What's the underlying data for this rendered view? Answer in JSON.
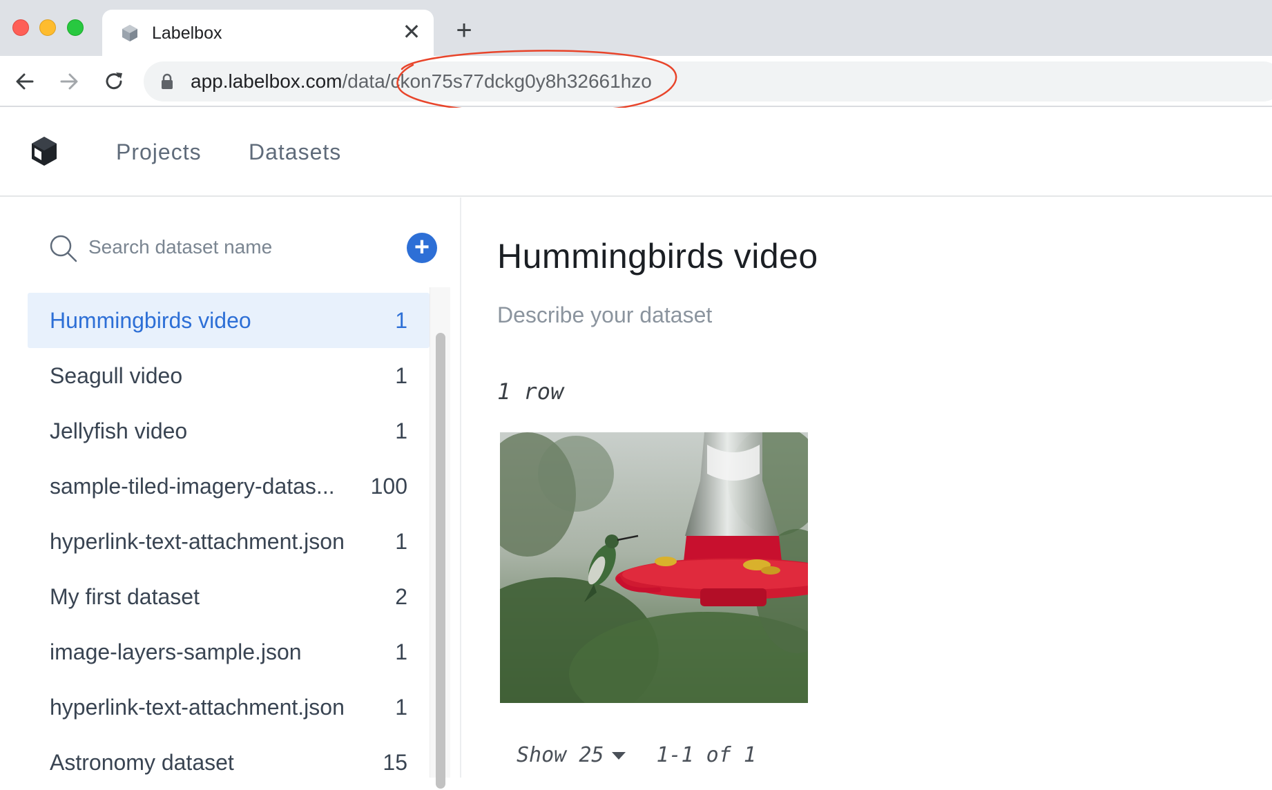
{
  "browser": {
    "tab_title": "Labelbox",
    "tab_close": "✕",
    "new_tab": "+",
    "url_host": "app.labelbox.com",
    "url_path": "/data/ckon75s77dckg0y8h32661hzo"
  },
  "header": {
    "nav": [
      {
        "label": "Projects"
      },
      {
        "label": "Datasets"
      }
    ]
  },
  "sidebar": {
    "search_placeholder": "Search dataset name",
    "add_icon": "+",
    "datasets": [
      {
        "name": "Hummingbirds video",
        "count": "1",
        "selected": true
      },
      {
        "name": "Seagull video",
        "count": "1"
      },
      {
        "name": "Jellyfish video",
        "count": "1"
      },
      {
        "name": "sample-tiled-imagery-datas...",
        "count": "100"
      },
      {
        "name": "hyperlink-text-attachment.json",
        "count": "1"
      },
      {
        "name": "My first dataset",
        "count": "2"
      },
      {
        "name": "image-layers-sample.json",
        "count": "1"
      },
      {
        "name": "hyperlink-text-attachment.json",
        "count": "1"
      },
      {
        "name": "Astronomy dataset",
        "count": "15"
      }
    ]
  },
  "main": {
    "title": "Hummingbirds video",
    "description_placeholder": "Describe your dataset",
    "row_count": "1 row",
    "pagination": {
      "show_label": "Show",
      "page_size": "25",
      "range": "1-1 of 1"
    }
  },
  "colors": {
    "accent": "#2d6fd6",
    "selected_bg": "#e8f1fc",
    "annotation": "#e8442a"
  }
}
